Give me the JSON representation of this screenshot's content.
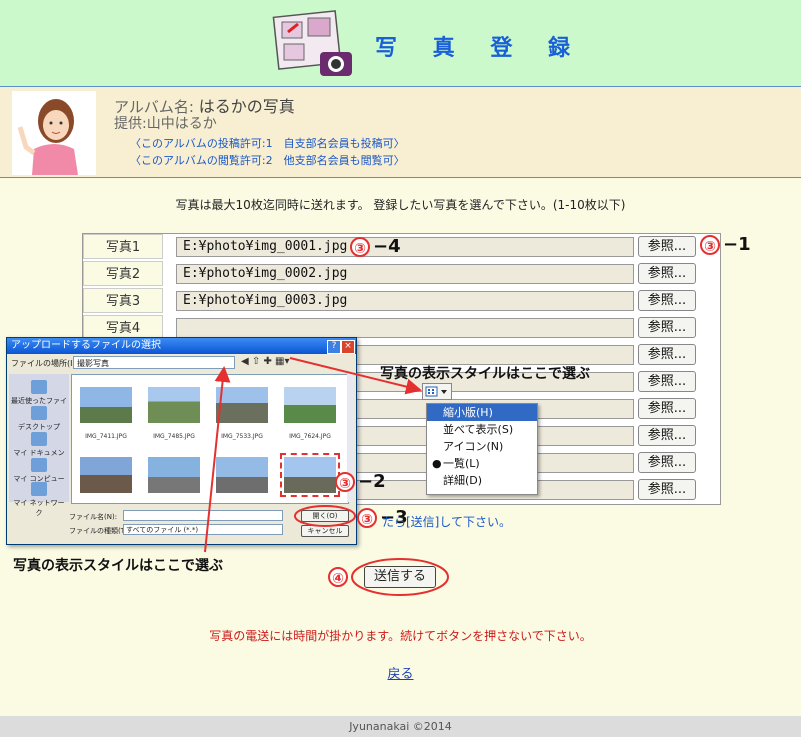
{
  "header": {
    "title": "写 真 登 録"
  },
  "album": {
    "name_label": "アルバム名:",
    "name": "はるかの写真",
    "provider": "提供:山中はるか",
    "post_permission": "〈このアルバムの投稿許可:1　自支部名会員も投稿可〉",
    "view_permission": "〈このアルバムの閲覧許可:2　他支部名会員も閲覧可〉"
  },
  "instruction": "写真は最大10枚迄同時に送れます。 登録したい写真を選んで下さい。(1-10枚以下)",
  "photos": [
    {
      "label": "写真1",
      "value": "E:¥photo¥img_0001.jpg"
    },
    {
      "label": "写真2",
      "value": "E:¥photo¥img_0002.jpg"
    },
    {
      "label": "写真3",
      "value": "E:¥photo¥img_0003.jpg"
    },
    {
      "label": "写真4",
      "value": ""
    },
    {
      "label": "",
      "value": ""
    },
    {
      "label": "",
      "value": ""
    },
    {
      "label": "",
      "value": ""
    },
    {
      "label": "",
      "value": ""
    },
    {
      "label": "",
      "value": ""
    },
    {
      "label": "",
      "value": ""
    }
  ],
  "browse_label": "参照...",
  "annotations": {
    "a1": "③ −1",
    "a2": "③ −2",
    "a3": "③ −3",
    "a4": "③ −4",
    "a5": "④",
    "circle3": "③",
    "dash1": "−1",
    "dash2": "−2",
    "dash3": "−3",
    "dash4": "−4",
    "circle4": "④"
  },
  "callout_view_style": "写真の表示スタイルはここで選ぶ",
  "dialog": {
    "title": "アップロードするファイルの選択",
    "location_label": "ファイルの場所(I):",
    "location_value": "撮影写真",
    "sidebar": [
      "最近使ったファイル",
      "デスクトップ",
      "マイ ドキュメント",
      "マイ コンピュータ",
      "マイ ネットワーク"
    ],
    "files": [
      "IMG_7411.JPG",
      "IMG_7485.JPG",
      "IMG_7533.JPG",
      "IMG_7624.JPG"
    ],
    "filename_label": "ファイル名(N):",
    "filetype_label": "ファイルの種類(T):",
    "filetype_value": "すべてのファイル (*.*)",
    "open_label": "開く(O)",
    "cancel_label": "キャンセル"
  },
  "view_menu": [
    "縮小版(H)",
    "並べて表示(S)",
    "アイコン(N)",
    "一覧(L)",
    "詳細(D)"
  ],
  "after_select_text": "たら[送信]して下さい。",
  "submit_label": "送信する",
  "warning": "写真の電送には時間が掛かります。続けてボタンを押さないで下さい。",
  "back_link": "戻る",
  "footer": "Jyunanakai ©2014",
  "colors": {
    "header_bg": "#ccf9cc",
    "accent": "#1960d8",
    "annotation": "#e53030"
  }
}
